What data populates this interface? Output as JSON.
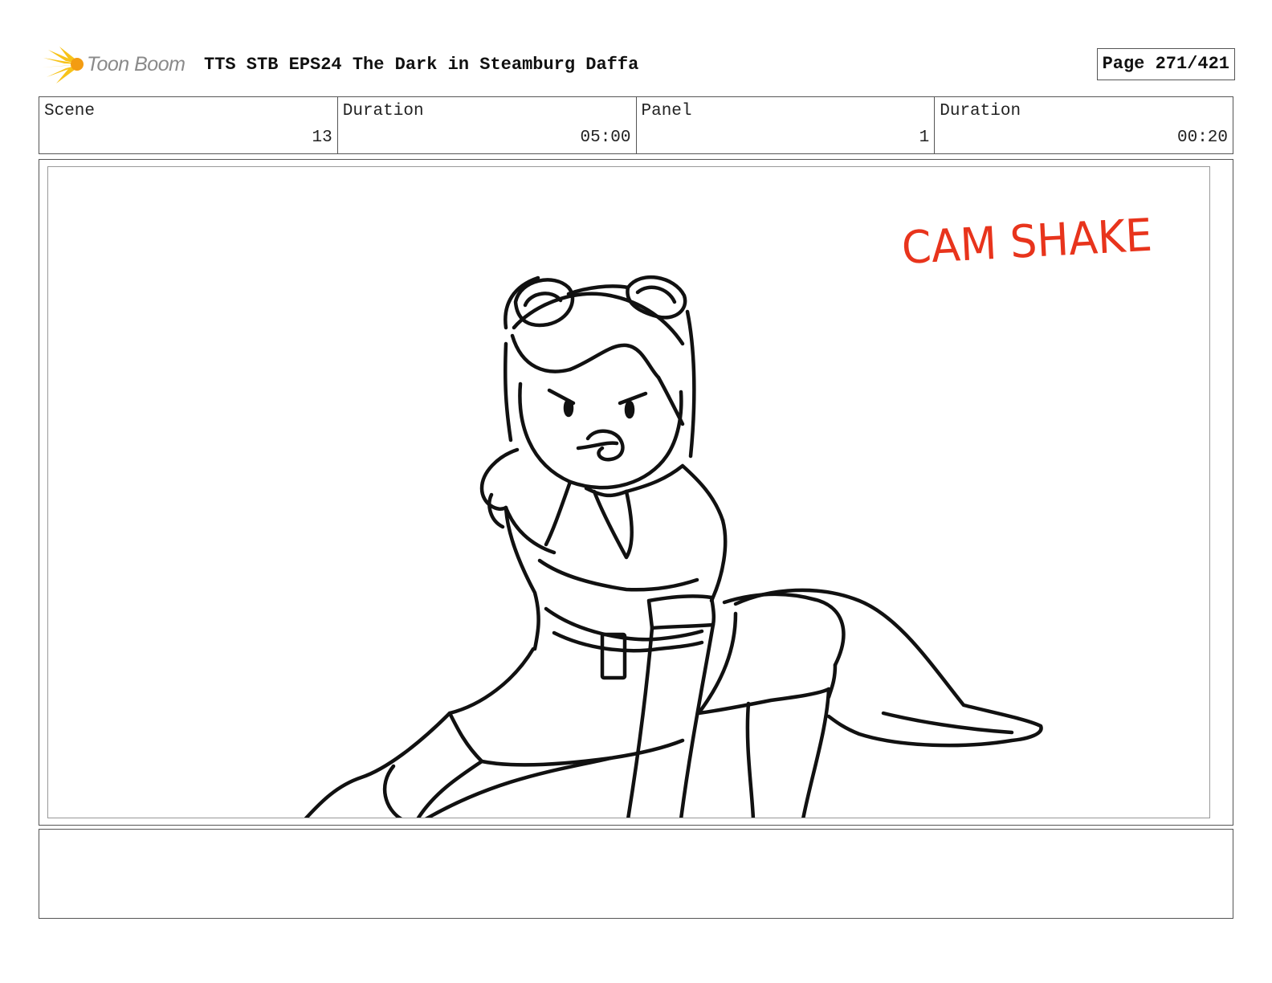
{
  "header": {
    "brand": "Toon Boom",
    "title": "TTS STB EPS24 The Dark in Steamburg Daffa",
    "page": "Page 271/421",
    "logo_icon": "toon-boom-burst-icon",
    "logo_color": "#f7c31a"
  },
  "info": {
    "scene_label": "Scene",
    "scene_value": "13",
    "scene_duration_label": "Duration",
    "scene_duration_value": "05:00",
    "panel_label": "Panel",
    "panel_value": "1",
    "panel_duration_label": "Duration",
    "panel_duration_value": "00:20"
  },
  "panel": {
    "annotation": "CAM SHAKE",
    "annotation_color": "#e8341c",
    "sketch_color": "#111111"
  },
  "notes": {
    "text": ""
  }
}
